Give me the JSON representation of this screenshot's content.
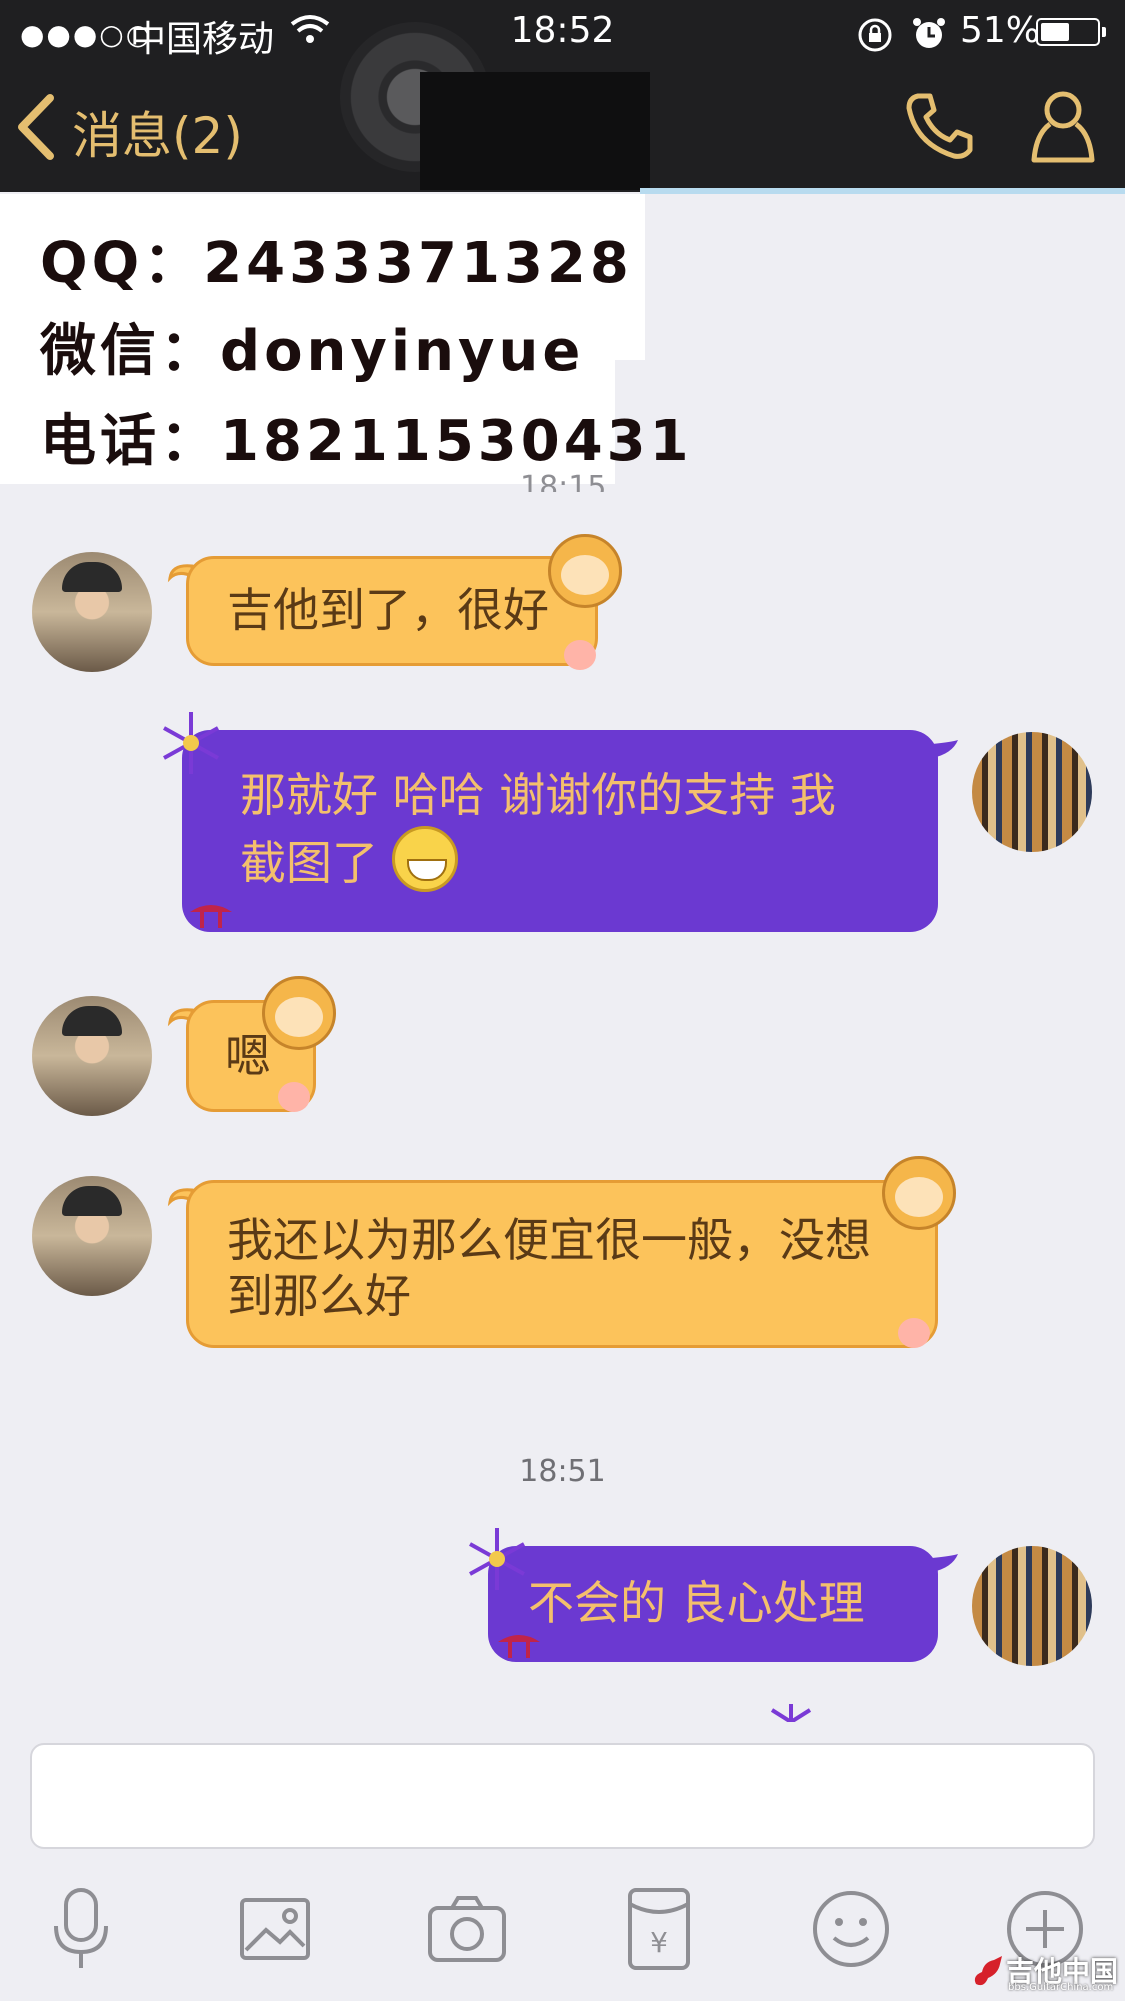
{
  "status_bar": {
    "signal": "●●●○○",
    "carrier": "中国移动",
    "time": "18:52",
    "battery_percent": "51%",
    "battery_level": 0.51
  },
  "nav": {
    "back_label": "消息(2)"
  },
  "contact_overlay": {
    "qq": "QQ：2433371328",
    "wechat": "微信：donyinyue",
    "phone": "电话：18211530431",
    "partial_timestamp": "18:15"
  },
  "messages": [
    {
      "side": "left",
      "text_lines": [
        "吉他到了，很好"
      ]
    },
    {
      "side": "right",
      "text_lines": [
        "那就好  哈哈 谢谢你的支持  我",
        "截图了"
      ]
    },
    {
      "side": "left",
      "text_lines": [
        "嗯"
      ]
    },
    {
      "side": "left",
      "text_lines": [
        "我还以为那么便宜很一般，没想",
        "到那么好"
      ]
    },
    {
      "timestamp": "18:51"
    },
    {
      "side": "right",
      "text_lines": [
        "不会的   良心处理"
      ]
    }
  ],
  "toolbar": {
    "icons": [
      "microphone-icon",
      "image-icon",
      "camera-icon",
      "red-packet-icon",
      "emoji-icon",
      "plus-icon"
    ]
  },
  "watermark": {
    "text": "吉他中国",
    "sub": "bbs.GuitarChina.com"
  },
  "colors": {
    "header_bg": "#1f1f21",
    "header_accent": "#e4be70",
    "chat_bg": "#eeeef3",
    "bubble_yellow": "#fcc35b",
    "bubble_purple": "#6b39d1"
  }
}
